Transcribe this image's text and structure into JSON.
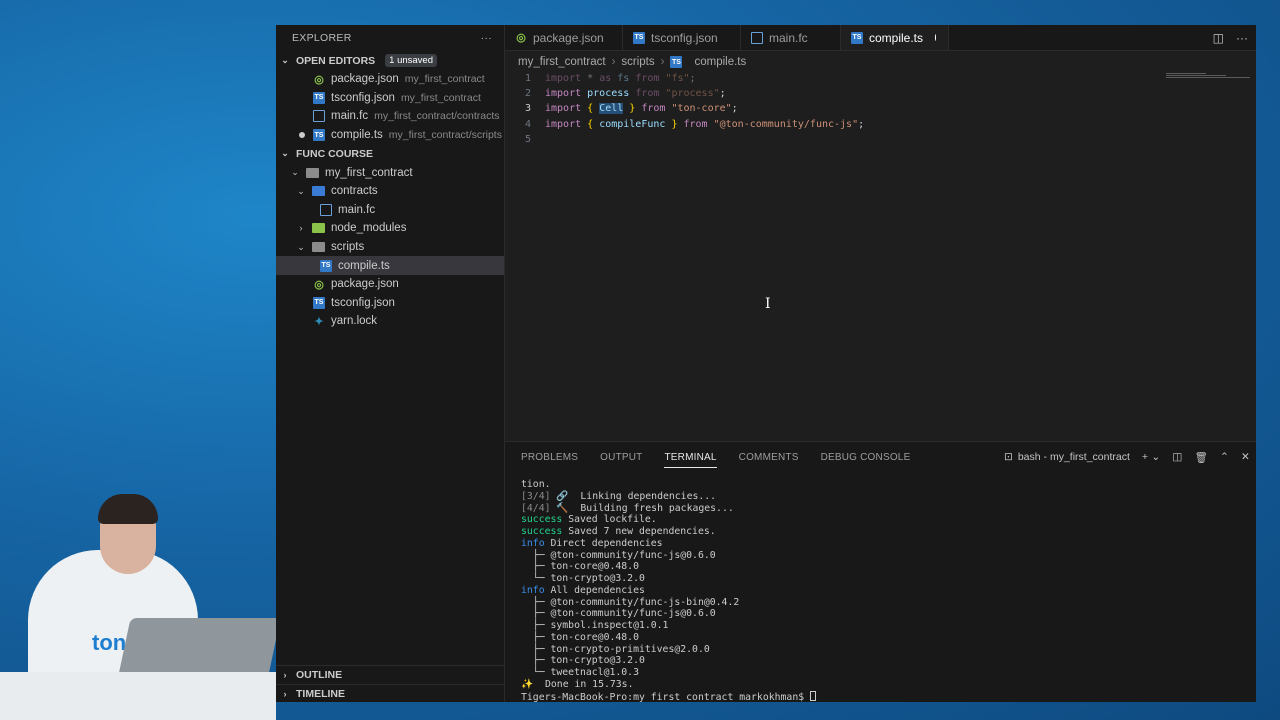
{
  "explorer": {
    "header": "EXPLORER",
    "more_icon": "ellipsis-icon",
    "open_editors": {
      "title": "OPEN EDITORS",
      "badge": "1 unsaved",
      "items": [
        {
          "name": "package.json",
          "path": "my_first_contract",
          "icon": "json-icon"
        },
        {
          "name": "tsconfig.json",
          "path": "my_first_contract",
          "icon": "ts-icon"
        },
        {
          "name": "main.fc",
          "path": "my_first_contract/contracts",
          "icon": "file-icon"
        },
        {
          "name": "compile.ts",
          "path": "my_first_contract/scripts",
          "icon": "ts-icon",
          "unsaved": true
        }
      ]
    },
    "workspace": {
      "title": "FUNC COURSE",
      "root": "my_first_contract",
      "contracts": "contracts",
      "main_fc": "main.fc",
      "node_modules": "node_modules",
      "scripts": "scripts",
      "compile_ts": "compile.ts",
      "package_json": "package.json",
      "tsconfig_json": "tsconfig.json",
      "yarn_lock": "yarn.lock"
    },
    "outline": "OUTLINE",
    "timeline": "TIMELINE"
  },
  "tabs": [
    {
      "label": "package.json",
      "icon": "json-icon"
    },
    {
      "label": "tsconfig.json",
      "icon": "ts-icon"
    },
    {
      "label": "main.fc",
      "icon": "file-icon"
    },
    {
      "label": "compile.ts",
      "icon": "ts-icon",
      "active": true,
      "modified": true
    }
  ],
  "breadcrumb": [
    "my_first_contract",
    "scripts",
    "compile.ts"
  ],
  "editor": {
    "line_numbers": [
      "1",
      "2",
      "3",
      "4",
      "5"
    ],
    "current_line": 3,
    "selected_text": "Cell",
    "lines": [
      "import * as fs from \"fs\";",
      "import process from \"process\";",
      "import { Cell } from \"ton-core\";",
      "import { compileFunc } from \"@ton-community/func-js\";",
      ""
    ]
  },
  "panel": {
    "tabs": [
      "PROBLEMS",
      "OUTPUT",
      "TERMINAL",
      "COMMENTS",
      "DEBUG CONSOLE"
    ],
    "active_tab": "TERMINAL",
    "terminal_name": "bash - my_first_contract",
    "terminal": {
      "l1": "tion.",
      "l2_step": "[3/4]",
      "l2_text": "🔗  Linking dependencies...",
      "l3_step": "[4/4]",
      "l3_text": "🔨  Building fresh packages...",
      "l4_tag": "success",
      "l4_text": " Saved lockfile.",
      "l5_tag": "success",
      "l5_text": " Saved 7 new dependencies.",
      "l6_tag": "info",
      "l6_text": " Direct dependencies",
      "direct": [
        "├─ @ton-community/func-js@0.6.0",
        "├─ ton-core@0.48.0",
        "└─ ton-crypto@3.2.0"
      ],
      "l10_tag": "info",
      "l10_text": " All dependencies",
      "all": [
        "├─ @ton-community/func-js-bin@0.4.2",
        "├─ @ton-community/func-js@0.6.0",
        "├─ symbol.inspect@1.0.1",
        "├─ ton-core@0.48.0",
        "├─ ton-crypto-primitives@2.0.0",
        "├─ ton-crypto@3.2.0",
        "└─ tweetnacl@1.0.3"
      ],
      "done_icon": "✨",
      "done_text": "  Done in 15.73s.",
      "prompt": "Tigers-MacBook-Pro:my_first_contract markokhman$ "
    }
  },
  "colors": {
    "background": "#1664a3",
    "editor": "#1e1e1e",
    "sidebar": "#181818",
    "ts_icon": "#3178c6",
    "terminal_success": "#23d18b",
    "terminal_info": "#3b8eea"
  }
}
